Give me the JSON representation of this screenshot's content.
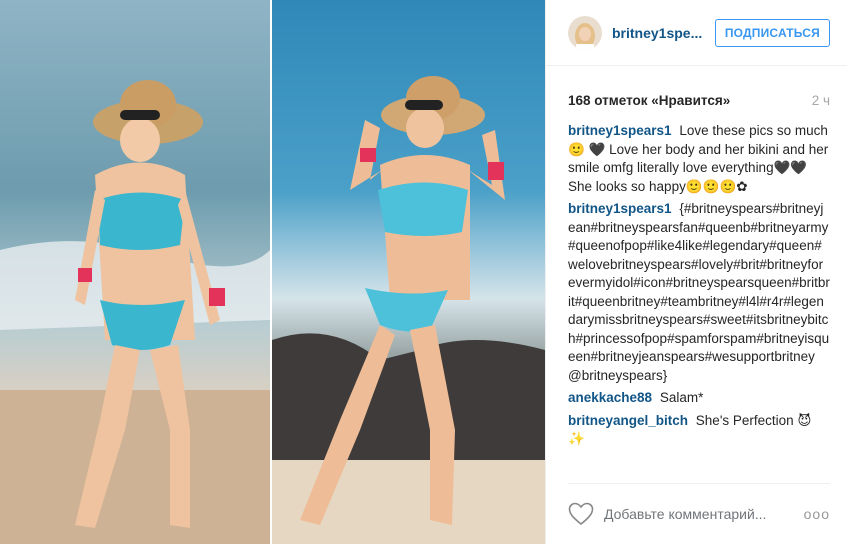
{
  "post": {
    "username": "britney1spe...",
    "follow_label": "ПОДПИСАТЬСЯ",
    "likes": "168 отметок «Нравится»",
    "time": "2 ч",
    "comments": [
      {
        "author": "britney1spears1",
        "text": "Love these pics so much🙂 🖤 Love her body and her bikini and her smile omfg literally love everything🖤🖤She looks so happy🙂🙂🙂✿"
      },
      {
        "author": "britney1spears1",
        "text": "{#britneyspears#britneyjean#britneyspearsfan#queenb#britneyarmy#queenofpop#like4like#legendary#queen#welovebritneyspears#lovely#brit#britneyforevermyidol#icon#britneyspearsqueen#britbrit#queenbritney#teambritney#l4l#r4r#legendarymissbritneyspears#sweet#itsbritneybitch#princessofpop#spamforspam#britneyisqueen#britneyjeanspears#wesupportbritney @britneyspears}"
      },
      {
        "author": "anekkache88",
        "text": "Salam*"
      },
      {
        "author": "britneyangel_bitch",
        "text": "She's Perfection 😈 ✨"
      }
    ],
    "add_comment_placeholder": "Добавьте комментарий...",
    "more_label": "ooo"
  },
  "icons": {
    "heart": "heart-outline-icon",
    "more": "more-options-icon"
  },
  "colors": {
    "link": "#125688",
    "follow": "#3897f0",
    "muted": "#a5a7aa"
  }
}
